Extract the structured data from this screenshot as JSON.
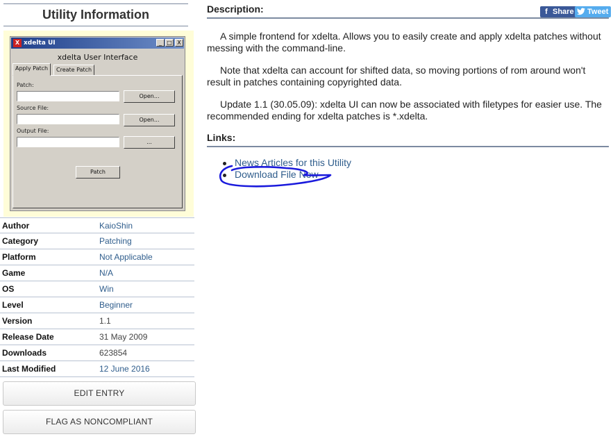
{
  "sidebar": {
    "title": "Utility Information",
    "screenshot": {
      "window_title": "xdelta UI",
      "heading": "xdelta User Interface",
      "tabs": [
        "Apply Patch",
        "Create Patch"
      ],
      "fields": [
        {
          "label": "Patch:",
          "button": "Open..."
        },
        {
          "label": "Source File:",
          "button": "Open..."
        },
        {
          "label": "Output File:",
          "button": "..."
        }
      ],
      "action_button": "Patch",
      "controls": [
        "_",
        "□",
        "X"
      ]
    },
    "info": [
      {
        "key": "Author",
        "value": "KaioShin",
        "link": true
      },
      {
        "key": "Category",
        "value": "Patching",
        "link": true
      },
      {
        "key": "Platform",
        "value": "Not Applicable",
        "link": true
      },
      {
        "key": "Game",
        "value": "N/A",
        "link": true
      },
      {
        "key": "OS",
        "value": "Win",
        "link": true
      },
      {
        "key": "Level",
        "value": "Beginner",
        "link": true
      },
      {
        "key": "Version",
        "value": "1.1",
        "link": false
      },
      {
        "key": "Release Date",
        "value": "31 May 2009",
        "link": false
      },
      {
        "key": "Downloads",
        "value": "623854",
        "link": false
      },
      {
        "key": "Last Modified",
        "value": "12 June 2016",
        "link": true
      }
    ],
    "buttons": {
      "edit": "EDIT ENTRY",
      "flag": "FLAG AS NONCOMPLIANT"
    }
  },
  "main": {
    "description_heading": "Description:",
    "share": {
      "facebook": "Share",
      "twitter": "Tweet"
    },
    "paragraphs": [
      "A simple frontend for xdelta. Allows you to easily create and apply xdelta patches without messing with the command-line.",
      "Note that xdelta can account for shifted data, so moving portions of rom around won't result in patches containing copyrighted data.",
      "Update 1.1 (30.05.09): xdelta UI can now be associated with filetypes for easier use. The recommended ending for xdelta patches is *.xdelta."
    ],
    "links_heading": "Links:",
    "links": [
      "News Articles for this Utility",
      "Download File Now"
    ]
  },
  "colors": {
    "link": "#2f5d8c",
    "rule": "#7c8aa0",
    "screenshot_bg": "#fffdd8",
    "facebook": "#3b5998",
    "twitter": "#55acee",
    "annotation": "#1a1adc"
  }
}
